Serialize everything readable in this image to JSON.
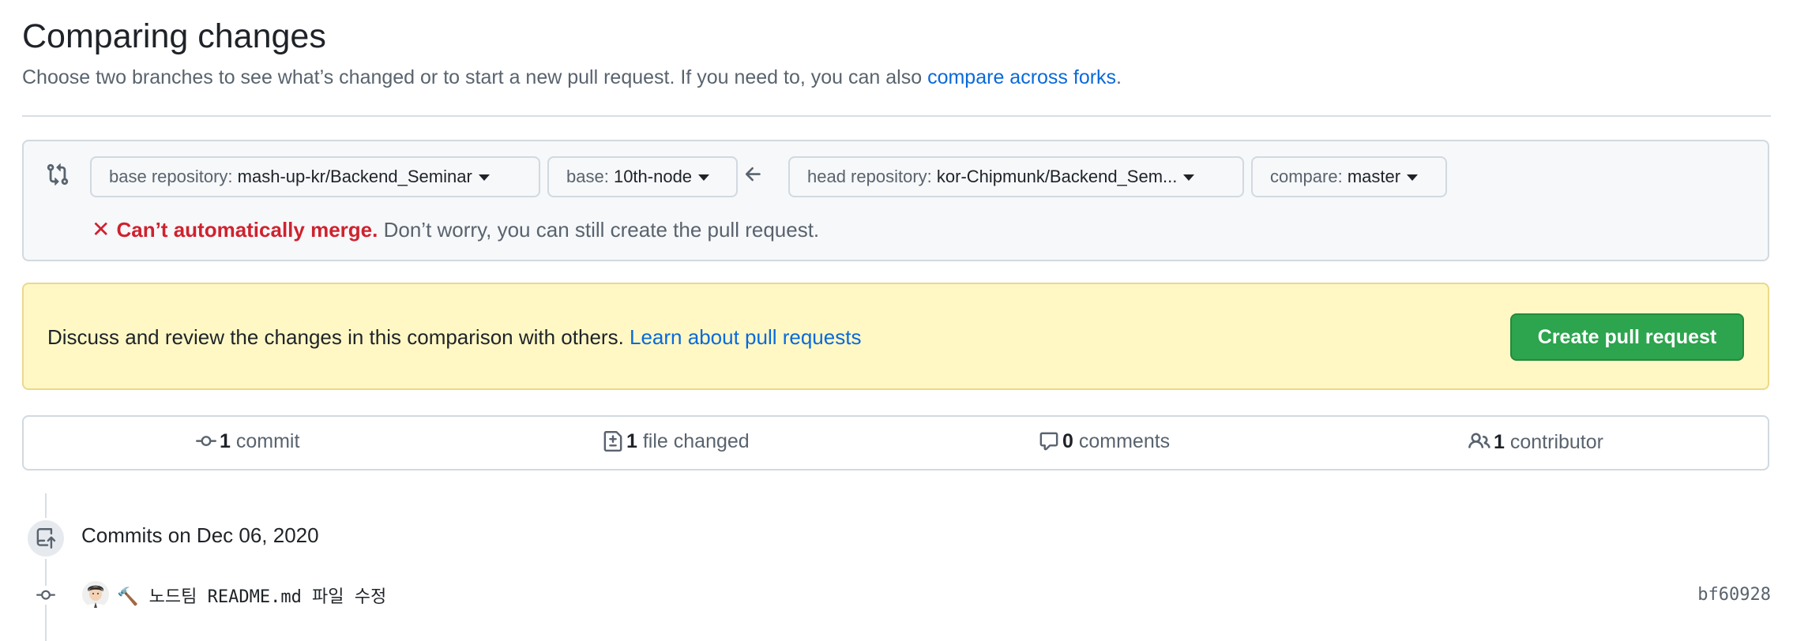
{
  "page": {
    "title": "Comparing changes",
    "subtitle_text": "Choose two branches to see what’s changed or to start a new pull request. If you need to, you can also ",
    "subtitle_link": "compare across forks",
    "subtitle_end": "."
  },
  "range_editor": {
    "icon": "git-compare-icon",
    "base_repository": {
      "label": "base repository:",
      "value": "mash-up-kr/Backend_Seminar"
    },
    "base": {
      "label": "base:",
      "value": "10th-node"
    },
    "arrow_icon": "arrow-left-icon",
    "head_repository": {
      "label": "head repository:",
      "value": "kor-Chipmunk/Backend_Sem..."
    },
    "compare": {
      "label": "compare:",
      "value": "master"
    },
    "merge_status": {
      "icon": "x-icon",
      "icon_glyph": "✕",
      "error": "Can’t automatically merge.",
      "note": "Don’t worry, you can still create the pull request."
    }
  },
  "flash": {
    "text": "Discuss and review the changes in this comparison with others. ",
    "link": "Learn about pull requests",
    "button": "Create pull request"
  },
  "stats": {
    "commits": {
      "icon": "git-commit-icon",
      "count": "1",
      "label": "commit"
    },
    "files": {
      "icon": "file-diff-icon",
      "count": "1",
      "label": "file changed"
    },
    "comments": {
      "icon": "comment-icon",
      "count": "0",
      "label": "comments"
    },
    "contributors": {
      "icon": "people-icon",
      "count": "1",
      "label": "contributor"
    }
  },
  "timeline": {
    "group_icon": "repo-push-icon",
    "date_label": "Commits on Dec 06, 2020",
    "commits": [
      {
        "avatar": "user-avatar",
        "message": "🔨 노드팀 README.md 파일 수정",
        "sha": "bf60928"
      }
    ]
  },
  "colors": {
    "accent": "#0969da",
    "danger": "#cf222e",
    "primary_button": "#2da44e",
    "flash_bg": "#fff8c5"
  }
}
